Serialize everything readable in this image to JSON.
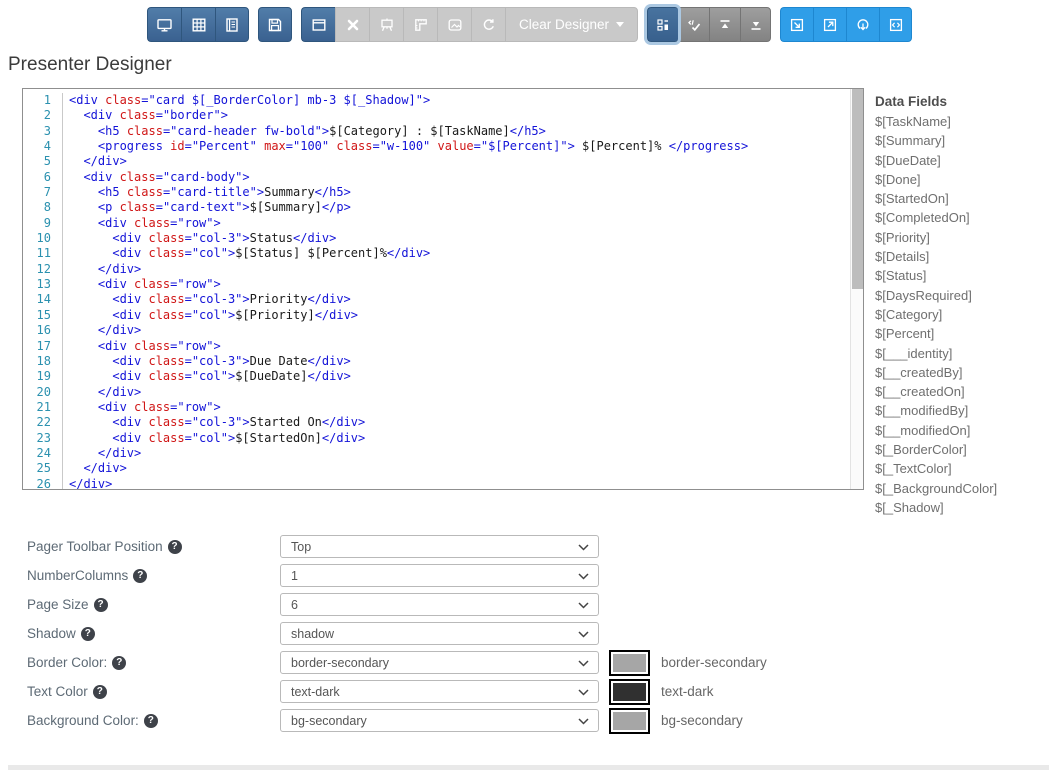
{
  "page_title": "Presenter Designer",
  "toolbar": {
    "groups": [
      {
        "name": "view-group",
        "buttons": [
          {
            "name": "desktop-preview-button",
            "icon": "monitor-icon",
            "style": "blue"
          },
          {
            "name": "grid-preview-button",
            "icon": "table-icon",
            "style": "blue"
          },
          {
            "name": "list-preview-button",
            "icon": "list-icon",
            "style": "blue"
          }
        ]
      },
      {
        "name": "save-group",
        "buttons": [
          {
            "name": "save-button",
            "icon": "save-icon",
            "style": "blue"
          }
        ]
      },
      {
        "name": "designer-actions-group",
        "buttons": [
          {
            "name": "window-preview-button",
            "icon": "window-icon",
            "style": "blue"
          },
          {
            "name": "delete-button",
            "icon": "cross-icon",
            "style": "disabled"
          },
          {
            "name": "easel-button",
            "icon": "easel-icon",
            "style": "disabled"
          },
          {
            "name": "ruler-button",
            "icon": "ruler-icon",
            "style": "disabled"
          },
          {
            "name": "image-button",
            "icon": "image-icon",
            "style": "disabled"
          },
          {
            "name": "refresh-button",
            "icon": "refresh-icon",
            "style": "disabled"
          },
          {
            "name": "clear-designer-button",
            "label": "Clear Designer",
            "caret": true,
            "style": "disabled",
            "wide": true
          }
        ]
      },
      {
        "name": "layout-group",
        "buttons": [
          {
            "name": "designer-layout-button",
            "icon": "layout-blocks-icon",
            "style": "dark",
            "active": true
          },
          {
            "name": "validate-button",
            "icon": "code-check-icon",
            "style": "dark"
          },
          {
            "name": "collapse-top-button",
            "icon": "collapse-top-icon",
            "style": "dark"
          },
          {
            "name": "collapse-bottom-button",
            "icon": "collapse-bottom-icon",
            "style": "dark"
          }
        ]
      },
      {
        "name": "export-group",
        "buttons": [
          {
            "name": "shrink-window-button",
            "icon": "arrow-into-box-icon",
            "style": "bright"
          },
          {
            "name": "open-external-button",
            "icon": "arrow-out-box-icon",
            "style": "bright"
          },
          {
            "name": "download-button",
            "icon": "download-icon",
            "style": "bright"
          },
          {
            "name": "view-source-button",
            "icon": "code-box-icon",
            "style": "bright"
          }
        ]
      }
    ]
  },
  "editor": {
    "lines": [
      [
        [
          "t",
          "<div "
        ],
        [
          "a",
          "class"
        ],
        [
          "v",
          "=\"card $[_BorderColor] mb-3 $[_Shadow]\""
        ],
        [
          "t",
          ">"
        ]
      ],
      [
        [
          "x",
          "  "
        ],
        [
          "t",
          "<div "
        ],
        [
          "a",
          "class"
        ],
        [
          "v",
          "=\"border\""
        ],
        [
          "t",
          ">"
        ]
      ],
      [
        [
          "x",
          "    "
        ],
        [
          "t",
          "<h5 "
        ],
        [
          "a",
          "class"
        ],
        [
          "v",
          "=\"card-header fw-bold\""
        ],
        [
          "t",
          ">"
        ],
        [
          "x",
          "$[Category] : $[TaskName]"
        ],
        [
          "t",
          "</h5>"
        ]
      ],
      [
        [
          "x",
          "    "
        ],
        [
          "t",
          "<progress "
        ],
        [
          "a",
          "id"
        ],
        [
          "v",
          "=\"Percent\" "
        ],
        [
          "a",
          "max"
        ],
        [
          "v",
          "=\"100\" "
        ],
        [
          "a",
          "class"
        ],
        [
          "v",
          "=\"w-100\" "
        ],
        [
          "a",
          "value"
        ],
        [
          "v",
          "=\"$[Percent]\""
        ],
        [
          "t",
          ">"
        ],
        [
          "x",
          " $[Percent]% "
        ],
        [
          "t",
          "</progress>"
        ]
      ],
      [
        [
          "x",
          "  "
        ],
        [
          "t",
          "</div>"
        ]
      ],
      [
        [
          "x",
          "  "
        ],
        [
          "t",
          "<div "
        ],
        [
          "a",
          "class"
        ],
        [
          "v",
          "=\"card-body\""
        ],
        [
          "t",
          ">"
        ]
      ],
      [
        [
          "x",
          "    "
        ],
        [
          "t",
          "<h5 "
        ],
        [
          "a",
          "class"
        ],
        [
          "v",
          "=\"card-title\""
        ],
        [
          "t",
          ">"
        ],
        [
          "x",
          "Summary"
        ],
        [
          "t",
          "</h5>"
        ]
      ],
      [
        [
          "x",
          "    "
        ],
        [
          "t",
          "<p "
        ],
        [
          "a",
          "class"
        ],
        [
          "v",
          "=\"card-text\""
        ],
        [
          "t",
          ">"
        ],
        [
          "x",
          "$[Summary]"
        ],
        [
          "t",
          "</p>"
        ]
      ],
      [
        [
          "x",
          "    "
        ],
        [
          "t",
          "<div "
        ],
        [
          "a",
          "class"
        ],
        [
          "v",
          "=\"row\""
        ],
        [
          "t",
          ">"
        ]
      ],
      [
        [
          "x",
          "      "
        ],
        [
          "t",
          "<div "
        ],
        [
          "a",
          "class"
        ],
        [
          "v",
          "=\"col-3\""
        ],
        [
          "t",
          ">"
        ],
        [
          "x",
          "Status"
        ],
        [
          "t",
          "</div>"
        ]
      ],
      [
        [
          "x",
          "      "
        ],
        [
          "t",
          "<div "
        ],
        [
          "a",
          "class"
        ],
        [
          "v",
          "=\"col\""
        ],
        [
          "t",
          ">"
        ],
        [
          "x",
          "$[Status] $[Percent]%"
        ],
        [
          "t",
          "</div>"
        ]
      ],
      [
        [
          "x",
          "    "
        ],
        [
          "t",
          "</div>"
        ]
      ],
      [
        [
          "x",
          "    "
        ],
        [
          "t",
          "<div "
        ],
        [
          "a",
          "class"
        ],
        [
          "v",
          "=\"row\""
        ],
        [
          "t",
          ">"
        ]
      ],
      [
        [
          "x",
          "      "
        ],
        [
          "t",
          "<div "
        ],
        [
          "a",
          "class"
        ],
        [
          "v",
          "=\"col-3\""
        ],
        [
          "t",
          ">"
        ],
        [
          "x",
          "Priority"
        ],
        [
          "t",
          "</div>"
        ]
      ],
      [
        [
          "x",
          "      "
        ],
        [
          "t",
          "<div "
        ],
        [
          "a",
          "class"
        ],
        [
          "v",
          "=\"col\""
        ],
        [
          "t",
          ">"
        ],
        [
          "x",
          "$[Priority]"
        ],
        [
          "t",
          "</div>"
        ]
      ],
      [
        [
          "x",
          "    "
        ],
        [
          "t",
          "</div>"
        ]
      ],
      [
        [
          "x",
          "    "
        ],
        [
          "t",
          "<div "
        ],
        [
          "a",
          "class"
        ],
        [
          "v",
          "=\"row\""
        ],
        [
          "t",
          ">"
        ]
      ],
      [
        [
          "x",
          "      "
        ],
        [
          "t",
          "<div "
        ],
        [
          "a",
          "class"
        ],
        [
          "v",
          "=\"col-3\""
        ],
        [
          "t",
          ">"
        ],
        [
          "x",
          "Due Date"
        ],
        [
          "t",
          "</div>"
        ]
      ],
      [
        [
          "x",
          "      "
        ],
        [
          "t",
          "<div "
        ],
        [
          "a",
          "class"
        ],
        [
          "v",
          "=\"col\""
        ],
        [
          "t",
          ">"
        ],
        [
          "x",
          "$[DueDate]"
        ],
        [
          "t",
          "</div>"
        ]
      ],
      [
        [
          "x",
          "    "
        ],
        [
          "t",
          "</div>"
        ]
      ],
      [
        [
          "x",
          "    "
        ],
        [
          "t",
          "<div "
        ],
        [
          "a",
          "class"
        ],
        [
          "v",
          "=\"row\""
        ],
        [
          "t",
          ">"
        ]
      ],
      [
        [
          "x",
          "      "
        ],
        [
          "t",
          "<div "
        ],
        [
          "a",
          "class"
        ],
        [
          "v",
          "=\"col-3\""
        ],
        [
          "t",
          ">"
        ],
        [
          "x",
          "Started On"
        ],
        [
          "t",
          "</div>"
        ]
      ],
      [
        [
          "x",
          "      "
        ],
        [
          "t",
          "<div "
        ],
        [
          "a",
          "class"
        ],
        [
          "v",
          "=\"col\""
        ],
        [
          "t",
          ">"
        ],
        [
          "x",
          "$[StartedOn]"
        ],
        [
          "t",
          "</div>"
        ]
      ],
      [
        [
          "x",
          "    "
        ],
        [
          "t",
          "</div>"
        ]
      ],
      [
        [
          "x",
          "  "
        ],
        [
          "t",
          "</div>"
        ]
      ],
      [
        [
          "t",
          "</div>"
        ]
      ]
    ]
  },
  "data_fields": {
    "title": "Data Fields",
    "items": [
      "$[TaskName]",
      "$[Summary]",
      "$[DueDate]",
      "$[Done]",
      "$[StartedOn]",
      "$[CompletedOn]",
      "$[Priority]",
      "$[Details]",
      "$[Status]",
      "$[DaysRequired]",
      "$[Category]",
      "$[Percent]",
      "$[___identity]",
      "$[__createdBy]",
      "$[__createdOn]",
      "$[__modifiedBy]",
      "$[__modifiedOn]",
      "$[_BorderColor]",
      "$[_TextColor]",
      "$[_BackgroundColor]",
      "$[_Shadow]"
    ]
  },
  "form": {
    "rows": [
      {
        "key": "pager-toolbar-position",
        "label": "Pager Toolbar Position",
        "value": "Top"
      },
      {
        "key": "number-columns",
        "label": "NumberColumns",
        "value": "1"
      },
      {
        "key": "page-size",
        "label": "Page Size",
        "value": "6"
      },
      {
        "key": "shadow",
        "label": "Shadow",
        "value": "shadow"
      },
      {
        "key": "border-color",
        "label": "Border Color:",
        "value": "border-secondary",
        "swatch_color": "#a6a6a6",
        "swatch_label": "border-secondary"
      },
      {
        "key": "text-color",
        "label": "Text Color",
        "value": "text-dark",
        "swatch_color": "#303030",
        "swatch_label": "text-dark"
      },
      {
        "key": "background-color",
        "label": "Background Color:",
        "value": "bg-secondary",
        "swatch_color": "#a6a6a6",
        "swatch_label": "bg-secondary"
      }
    ]
  },
  "colors": {
    "toolbar_blue": "#3a6190",
    "toolbar_disabled": "#c9c9c9",
    "toolbar_dark": "#8f8f8f",
    "toolbar_bright": "#2f9ee8",
    "active_halo": "#abc8e2",
    "line_number": "#2b91af",
    "code_tag_value": "#1313d8",
    "code_attribute": "#d01616",
    "swatch_gray": "#a6a6a6",
    "swatch_dark": "#303030"
  }
}
